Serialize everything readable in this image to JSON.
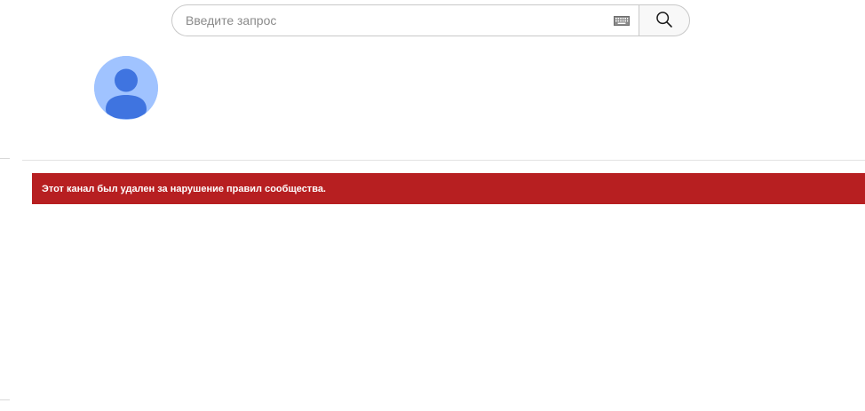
{
  "search": {
    "placeholder": "Введите запрос",
    "value": "",
    "keyboard_icon": "keyboard-icon",
    "button_icon": "search-icon"
  },
  "channel": {
    "avatar_icon": "default-avatar-icon"
  },
  "alert": {
    "message": "Этот канал был удален за нарушение правил сообщества."
  },
  "colors": {
    "alert_background": "#b71f21",
    "alert_text": "#ffffff",
    "avatar_background": "#a0c3ff",
    "avatar_figure": "#3f74e0",
    "search_border": "#c8c8c8",
    "search_button_background": "#f8f8f8"
  }
}
